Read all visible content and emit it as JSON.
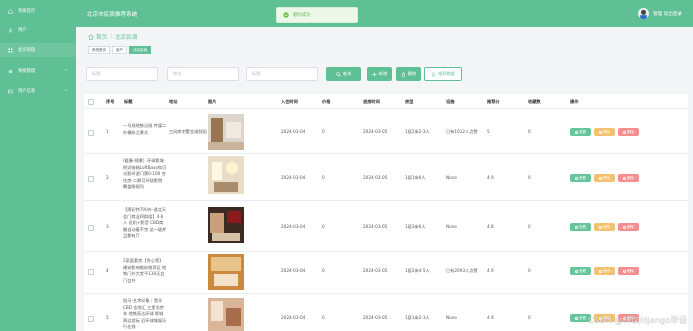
{
  "sidebar": {
    "items": [
      {
        "label": "系统首页"
      },
      {
        "label": "用户"
      },
      {
        "label": "北京民宿"
      },
      {
        "label": "系统管理"
      },
      {
        "label": "用户信息"
      }
    ]
  },
  "header": {
    "brand": "北京市民宿推荐系统",
    "toast": "删除成功",
    "user": "管理 退出登录"
  },
  "breadcrumb": {
    "home": "首页",
    "sep": "/",
    "current": "北京民宿"
  },
  "tabs": [
    "系统首页",
    "用户",
    "北京民宿"
  ],
  "search": {
    "field1": "标题",
    "field2": "地址",
    "field3": "标题",
    "query": "查询",
    "add": "新增",
    "delete": "删除",
    "recommend": "推荐数据"
  },
  "table": {
    "headers": [
      "序号",
      "标题",
      "地址",
      "图片",
      "入住时间",
      "价格",
      "退房时间",
      "房型",
      "设施",
      "推荐分",
      "收藏数",
      "操作"
    ],
    "rows": [
      {
        "idx": "1",
        "title": "一号线地铁沿线 传媒二外横纵之景式",
        "addr": "三间房宅墅金湖舒园",
        "checkin": "2024-03-04",
        "price": "0",
        "checkout": "2024-03-05",
        "room": "1居2床2-3人",
        "fac": "已有1012人点赞",
        "score": "5",
        "fav": "0"
      },
      {
        "idx": "2",
        "title": "(暖春-随景）环球影城附近暗暗LoftBase和可光影环游门票0-100 合住房-二期可环绕影院 覆盖眼视讯",
        "addr": "",
        "checkin": "2024-03-04",
        "price": "0",
        "checkout": "2024-03-05",
        "room": "1居1床6人",
        "fac": "None",
        "score": "4.9",
        "fav": "0"
      },
      {
        "idx": "3",
        "title": "【周初特700外-遥北天会门商业四群组】4-6人 近机+影音 CBD商圈自动看不完 这一级并且都有厅",
        "addr": "",
        "checkin": "2024-03-04",
        "price": "0",
        "checkout": "2024-03-05",
        "room": "1居3床6人",
        "fac": "None",
        "score": "4.8",
        "fav": "0"
      },
      {
        "idx": "4",
        "title": "2家庭套房【秀心等】横穿影响临街物资区 地铁门外大堂平130天会门会共",
        "addr": "",
        "checkin": "2024-03-04",
        "price": "0",
        "checkout": "2024-03-05",
        "room": "1居2床4-5人",
        "fac": "已有2093人点赞",
        "score": "4.9",
        "fav": "0"
      },
      {
        "idx": "5",
        "title": "阳马-艺术印象｜黑羊CBD 金地汇 三里屯京东 地铁直达环球 影城周边游玩 近环球城娱乐行在线",
        "addr": "",
        "checkin": "2024-03-04",
        "price": "0",
        "checkout": "2024-03-05",
        "room": "1居1床2-3人",
        "fac": "None",
        "score": "4.9",
        "fav": "0"
      }
    ],
    "actions": {
      "view": "查看",
      "edit": "修改",
      "del": "删除"
    }
  },
  "watermark": "CSDN @林次/django毕设"
}
